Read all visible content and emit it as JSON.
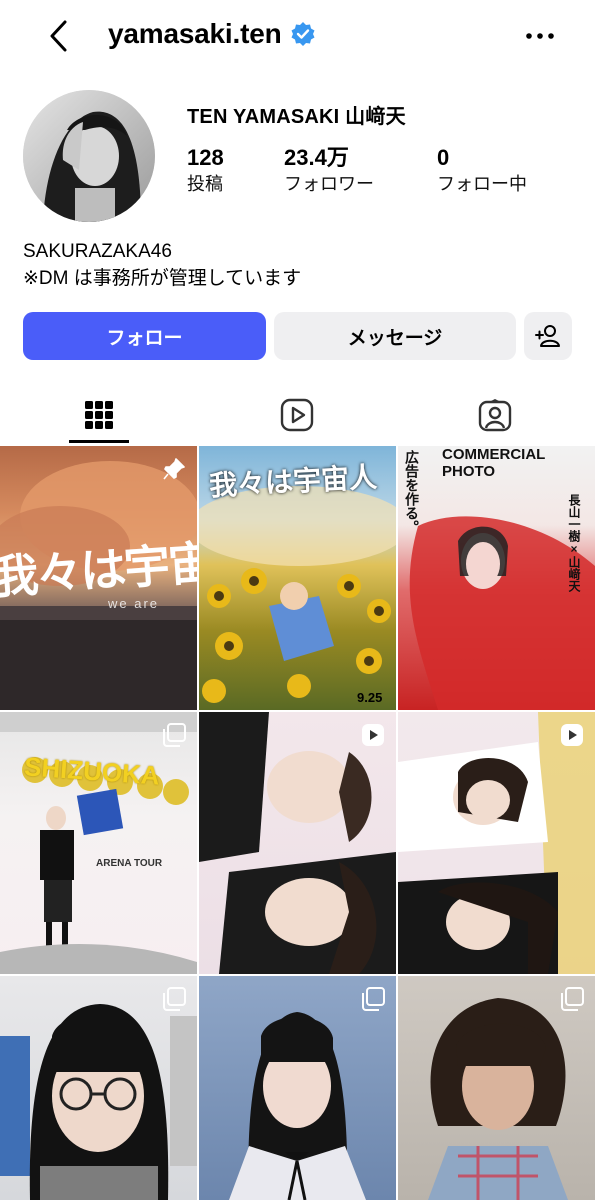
{
  "header": {
    "username": "yamasaki.ten",
    "back_icon": "chevron-left-icon",
    "verified_icon": "verified-badge-icon",
    "more_icon": "more-horizontal-icon"
  },
  "profile": {
    "display_name": "TEN YAMASAKI  山﨑天",
    "stats": {
      "posts_count": "128",
      "posts_label": "投稿",
      "followers_count": "23.4万",
      "followers_label": "フォロワー",
      "following_count": "0",
      "following_label": "フォロー中"
    },
    "bio": {
      "line1": "SAKURAZAKA46",
      "line2": "※DM は事務所が管理しています"
    }
  },
  "actions": {
    "follow_label": "フォロー",
    "message_label": "メッセージ",
    "suggest_icon": "add-person-icon"
  },
  "tabs": {
    "grid_icon": "grid-icon",
    "reels_icon": "reels-icon",
    "tagged_icon": "tagged-icon",
    "active": "grid"
  },
  "posts": [
    {
      "kind": "image",
      "pinned": true,
      "text": "我々は宇宙",
      "sub": "we are"
    },
    {
      "kind": "image",
      "pinned": false,
      "text": "我々は宇宙人",
      "date": "9.25"
    },
    {
      "kind": "image",
      "pinned": false,
      "text": "COMMERCIAL PHOTO",
      "text2": "広告を作る。",
      "text3": "長山一樹×山﨑天"
    },
    {
      "kind": "carousel",
      "pinned": false,
      "text": "SHIZUOKA",
      "sub": "ARENA TOUR"
    },
    {
      "kind": "reel",
      "pinned": false
    },
    {
      "kind": "reel",
      "pinned": false
    },
    {
      "kind": "carousel",
      "pinned": false
    },
    {
      "kind": "carousel",
      "pinned": false
    },
    {
      "kind": "carousel",
      "pinned": false
    }
  ],
  "colors": {
    "accent": "#4a5df9",
    "button_secondary": "#efeff1",
    "verified": "#3897f0"
  }
}
